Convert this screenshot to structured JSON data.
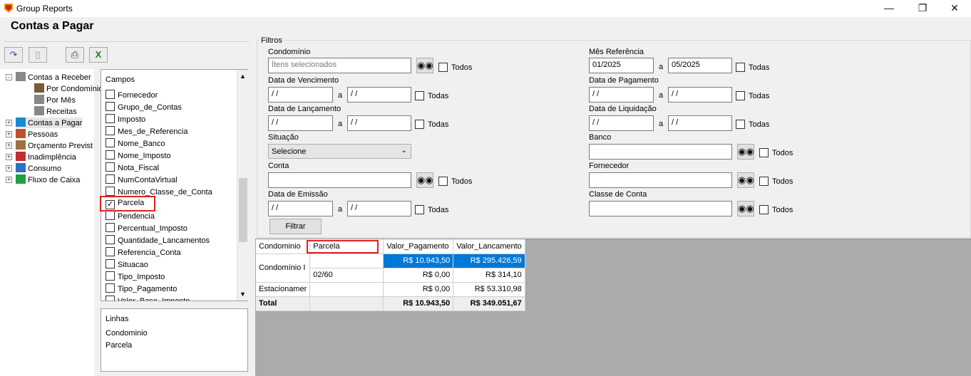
{
  "window": {
    "title": "Group Reports"
  },
  "page": {
    "title": "Contas a Pagar"
  },
  "toolbar": {
    "icons": [
      "export-icon",
      "delete-icon",
      "print-icon",
      "excel-icon"
    ]
  },
  "tree": {
    "items": [
      {
        "label": "Contas a Receber",
        "icon": "document-icon"
      },
      {
        "label": "Por Condomínio",
        "icon": "building-icon"
      },
      {
        "label": "Por Mês",
        "icon": "document-icon"
      },
      {
        "label": "Receitas",
        "icon": "document-icon"
      },
      {
        "label": "Contas a Pagar",
        "icon": "cart-icon"
      },
      {
        "label": "Pessoas",
        "icon": "people-icon"
      },
      {
        "label": "Orçamento Previst",
        "icon": "budget-icon"
      },
      {
        "label": "Inadimplência",
        "icon": "chart-icon"
      },
      {
        "label": "Consumo",
        "icon": "meter-icon"
      },
      {
        "label": "Fluxo de Caixa",
        "icon": "cash-icon"
      }
    ]
  },
  "campos": {
    "title": "Campos",
    "fields": [
      {
        "label": "Fornecedor",
        "checked": false
      },
      {
        "label": "Grupo_de_Contas",
        "checked": false
      },
      {
        "label": "Imposto",
        "checked": false
      },
      {
        "label": "Mes_de_Referencia",
        "checked": false
      },
      {
        "label": "Nome_Banco",
        "checked": false
      },
      {
        "label": "Nome_Imposto",
        "checked": false
      },
      {
        "label": "Nota_Fiscal",
        "checked": false
      },
      {
        "label": "NumContaVirtual",
        "checked": false
      },
      {
        "label": "Numero_Classe_de_Conta",
        "checked": false
      },
      {
        "label": "Parcela",
        "checked": true
      },
      {
        "label": "Pendencia",
        "checked": false
      },
      {
        "label": "Percentual_Imposto",
        "checked": false
      },
      {
        "label": "Quantidade_Lancamentos",
        "checked": false
      },
      {
        "label": "Referencia_Conta",
        "checked": false
      },
      {
        "label": "Situacao",
        "checked": false
      },
      {
        "label": "Tipo_Imposto",
        "checked": false
      },
      {
        "label": "Tipo_Pagamento",
        "checked": false
      },
      {
        "label": "Valor_Base_Imposto",
        "checked": false
      }
    ]
  },
  "linhas": {
    "title": "Linhas",
    "items": [
      "Condominio",
      "Parcela"
    ]
  },
  "filtros": {
    "title": "Filtros",
    "condominio": {
      "label": "Condomínio",
      "placeholder": "Ítens selecionados",
      "todos": "Todos"
    },
    "data_vencimento": {
      "label": "Data de Vencimento",
      "from": " / /",
      "a": "a",
      "to": " / /",
      "todas": "Todas"
    },
    "data_lancamento": {
      "label": "Data de Lançamento",
      "from": " / /",
      "a": "a",
      "to": " / /",
      "todas": "Todas"
    },
    "situacao": {
      "label": "Situação",
      "value": "Selecione"
    },
    "conta": {
      "label": "Conta",
      "value": "",
      "todos": "Todos"
    },
    "data_emissao": {
      "label": "Data de Emissão",
      "from": " / /",
      "a": "a",
      "to": " / /",
      "todas": "Todas"
    },
    "filtrar_label": "Filtrar",
    "mes_referencia": {
      "label": "Mês Referência",
      "from": "01/2025",
      "a": "a",
      "to": "05/2025",
      "todas": "Todas"
    },
    "data_pagamento": {
      "label": "Data de Pagamento",
      "from": " / /",
      "a": "a",
      "to": " / /",
      "todas": "Todas"
    },
    "data_liquidacao": {
      "label": "Data de Liquidação",
      "from": " / /",
      "a": "a",
      "to": " / /",
      "todas": "Todas"
    },
    "banco": {
      "label": "Banco",
      "value": "",
      "todos": "Todos"
    },
    "fornecedor": {
      "label": "Fornecedor",
      "value": "",
      "todos": "Todos"
    },
    "classe_conta": {
      "label": "Classe de Conta",
      "value": "",
      "todos": "Todos"
    }
  },
  "grid": {
    "headers": [
      "Condominio",
      "Parcela",
      "Valor_Pagamento",
      "Valor_Lancamento"
    ],
    "rows": [
      {
        "condominio": "Condomínio I",
        "parcela": "",
        "valor_pagamento": "R$ 10.943,50",
        "valor_lancamento": "R$ 295.426,59"
      },
      {
        "condominio": "",
        "parcela": "02/60",
        "valor_pagamento": "R$ 0,00",
        "valor_lancamento": "R$ 314,10"
      },
      {
        "condominio": "Estacionamer",
        "parcela": "",
        "valor_pagamento": "R$ 0,00",
        "valor_lancamento": "R$ 53.310,98"
      }
    ],
    "total": {
      "label": "Total",
      "valor_pagamento": "R$ 10.943,50",
      "valor_lancamento": "R$ 349.051,67"
    }
  },
  "colors": {
    "highlight": "#0078d7",
    "annotation": "#e02020",
    "grid_bg": "#ababab"
  }
}
